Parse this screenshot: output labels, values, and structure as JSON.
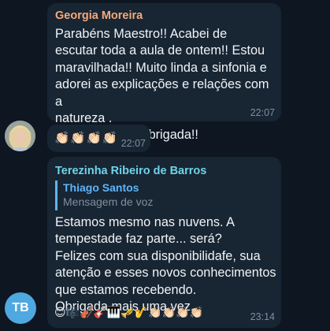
{
  "messages": [
    {
      "sender": "Georgia Moreira",
      "sender_color": "#f7a97a",
      "text": "Parabéns Maestro!! Acabei de\nescutar toda a aula de ontem!! Estou\nmaravilhada!! Muito linda a sinfonia e\nadorei as explicações e relações com a\nnatureza .\nAgudo/ grave. Obrigada!!",
      "time": "22:07"
    },
    {
      "emoji": "👏🏻👏🏻👏🏻👏🏻",
      "time": "22:07"
    },
    {
      "sender": "Terezinha Ribeiro de Barros",
      "sender_color": "#6fd3e8",
      "reply": {
        "author": "Thiago Santos",
        "text": "Mensagem de voz"
      },
      "text": "Estamos mesmo nas nuvens. A\ntempestade faz parte... será?\nFelizes com sua disponibilidafe, sua\natenção e esses novos conhecimentos\nque estamos recebendo.\nObrigada mais uma vez.",
      "emoji": "😊🎼🎻🎸🎹🎺🎷👏🏻👏🏻👏🏻👏🏻",
      "time": "23:14",
      "avatar_initials": "TB",
      "avatar_color": "#4fa8e0"
    }
  ]
}
